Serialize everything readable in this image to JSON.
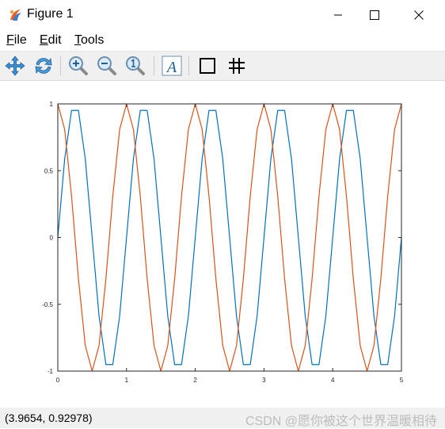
{
  "window": {
    "title": "Figure 1",
    "controls": {
      "minimize": "minimize",
      "maximize": "maximize",
      "close": "close"
    }
  },
  "menu": {
    "items": [
      {
        "first": "F",
        "rest": "ile"
      },
      {
        "first": "E",
        "rest": "dit"
      },
      {
        "first": "T",
        "rest": "ools"
      }
    ]
  },
  "toolbar": {
    "buttons": [
      "pan-icon",
      "rotate-icon",
      "zoom-in-icon",
      "zoom-out-icon",
      "zoom-reset-icon",
      "text-icon",
      "box-icon",
      "grid-icon"
    ],
    "text_button_glyph": "A"
  },
  "status": {
    "coordinates": "(3.9654, 0.92978)",
    "watermark": "CSDN @愿你被这个世界温暖相待"
  },
  "chart_data": {
    "type": "line",
    "xlim": [
      0,
      5
    ],
    "ylim": [
      -1,
      1
    ],
    "xticks": [
      "0",
      "1",
      "2",
      "3",
      "4",
      "5"
    ],
    "yticks": [
      "1",
      "0.5",
      "0",
      "-0.5",
      "-1"
    ],
    "grid": false,
    "series": [
      {
        "color": "#0072bd",
        "x": [
          0,
          0.1,
          0.2,
          0.3,
          0.4,
          0.5,
          0.6,
          0.7,
          0.8,
          0.9,
          1.0,
          1.1,
          1.2,
          1.3,
          1.4,
          1.5,
          1.6,
          1.7,
          1.8,
          1.9,
          2.0,
          2.1,
          2.2,
          2.3,
          2.4,
          2.5,
          2.6,
          2.7,
          2.8,
          2.9,
          3.0,
          3.1,
          3.2,
          3.3,
          3.4,
          3.5,
          3.6,
          3.7,
          3.8,
          3.9,
          4.0,
          4.1,
          4.2,
          4.3,
          4.4,
          4.5,
          4.6,
          4.7,
          4.8,
          4.9,
          5.0
        ],
        "y": [
          0,
          0.588,
          0.951,
          0.951,
          0.588,
          0,
          -0.588,
          -0.951,
          -0.951,
          -0.588,
          0,
          0.588,
          0.951,
          0.951,
          0.588,
          0,
          -0.588,
          -0.951,
          -0.951,
          -0.588,
          0,
          0.588,
          0.951,
          0.951,
          0.588,
          0,
          -0.588,
          -0.951,
          -0.951,
          -0.588,
          0,
          0.588,
          0.951,
          0.951,
          0.588,
          0,
          -0.588,
          -0.951,
          -0.951,
          -0.588,
          0,
          0.588,
          0.951,
          0.951,
          0.588,
          0,
          -0.588,
          -0.951,
          -0.951,
          -0.588,
          0
        ]
      },
      {
        "color": "#d95319",
        "x": [
          0,
          0.1,
          0.2,
          0.3,
          0.4,
          0.5,
          0.6,
          0.7,
          0.8,
          0.9,
          1.0,
          1.1,
          1.2,
          1.3,
          1.4,
          1.5,
          1.6,
          1.7,
          1.8,
          1.9,
          2.0,
          2.1,
          2.2,
          2.3,
          2.4,
          2.5,
          2.6,
          2.7,
          2.8,
          2.9,
          3.0,
          3.1,
          3.2,
          3.3,
          3.4,
          3.5,
          3.6,
          3.7,
          3.8,
          3.9,
          4.0,
          4.1,
          4.2,
          4.3,
          4.4,
          4.5,
          4.6,
          4.7,
          4.8,
          4.9,
          5.0
        ],
        "y": [
          1,
          0.809,
          0.309,
          -0.309,
          -0.809,
          -1,
          -0.809,
          -0.309,
          0.309,
          0.809,
          1,
          0.809,
          0.309,
          -0.309,
          -0.809,
          -1,
          -0.809,
          -0.309,
          0.309,
          0.809,
          1,
          0.809,
          0.309,
          -0.309,
          -0.809,
          -1,
          -0.809,
          -0.309,
          0.309,
          0.809,
          1,
          0.809,
          0.309,
          -0.309,
          -0.809,
          -1,
          -0.809,
          -0.309,
          0.309,
          0.809,
          1,
          0.809,
          0.309,
          -0.309,
          -0.809,
          -1,
          -0.809,
          -0.309,
          0.309,
          0.809,
          1
        ]
      }
    ]
  }
}
